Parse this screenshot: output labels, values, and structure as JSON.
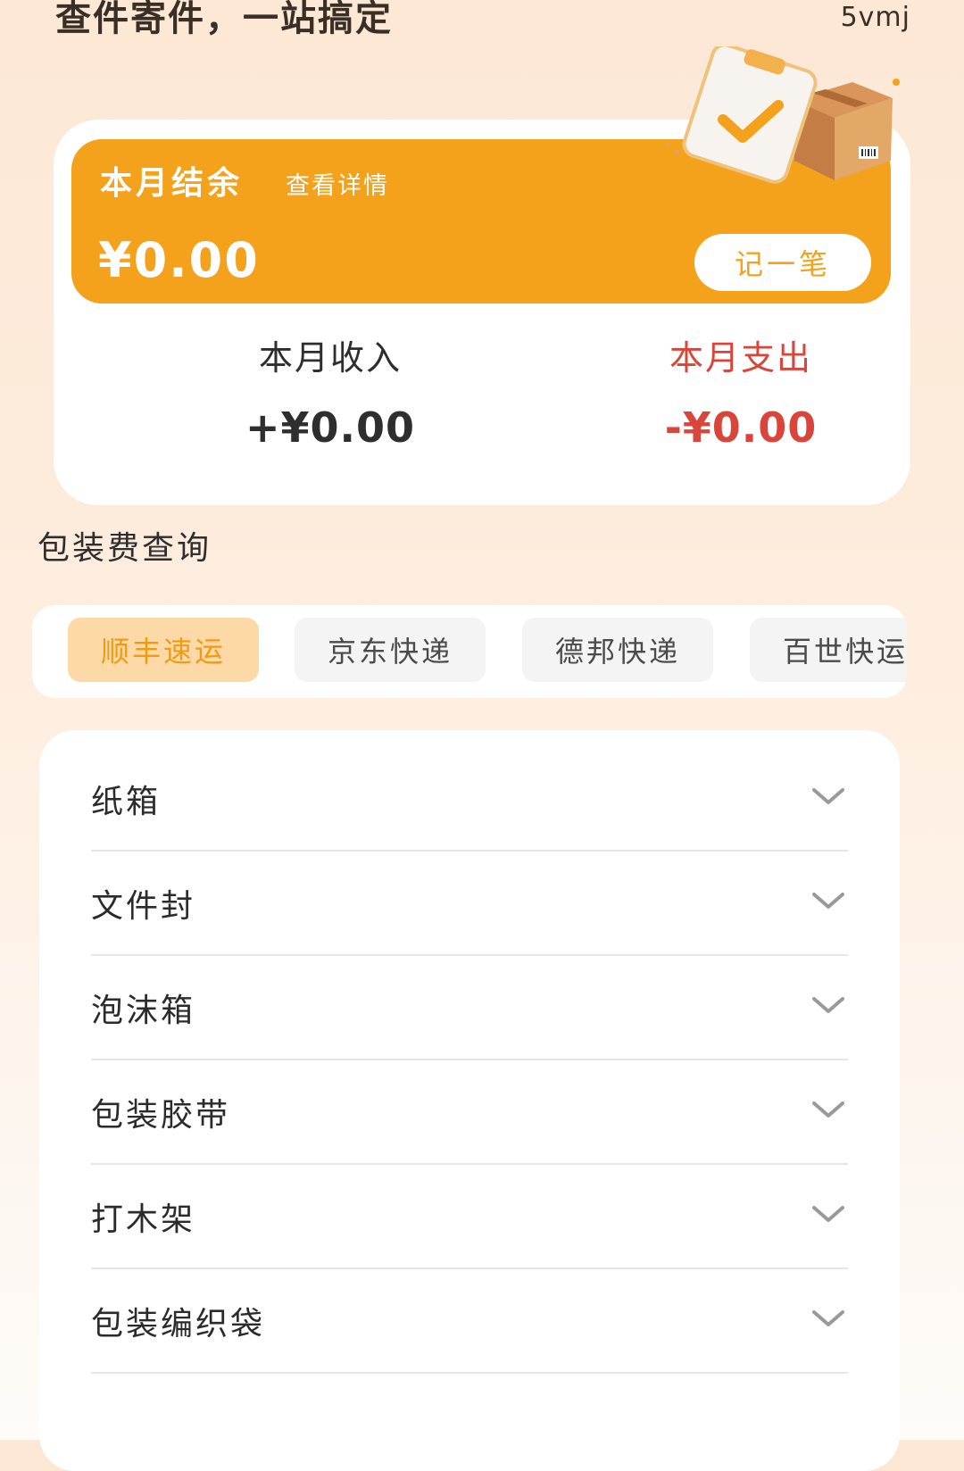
{
  "header": {
    "title": "查件寄件，一站搞定",
    "tag": "5vmj"
  },
  "summary": {
    "balance_label": "本月结余",
    "detail_link": "查看详情",
    "balance_amount": "¥0.00",
    "record_button": "记一笔",
    "income_label": "本月收入",
    "income_value": "+¥0.00",
    "expense_label": "本月支出",
    "expense_value": "-¥0.00"
  },
  "packaging": {
    "title": "包装费查询",
    "tabs": [
      {
        "label": "顺丰速运",
        "active": true
      },
      {
        "label": "京东快递",
        "active": false
      },
      {
        "label": "德邦快递",
        "active": false
      },
      {
        "label": "百世快运",
        "active": false
      }
    ],
    "items": [
      {
        "label": "纸箱"
      },
      {
        "label": "文件封"
      },
      {
        "label": "泡沫箱"
      },
      {
        "label": "包装胶带"
      },
      {
        "label": "打木架"
      },
      {
        "label": "包装编织袋"
      }
    ]
  },
  "colors": {
    "accent": "#f4a11c",
    "expense": "#d9453b",
    "active_tab_bg": "#fcd9a6"
  }
}
